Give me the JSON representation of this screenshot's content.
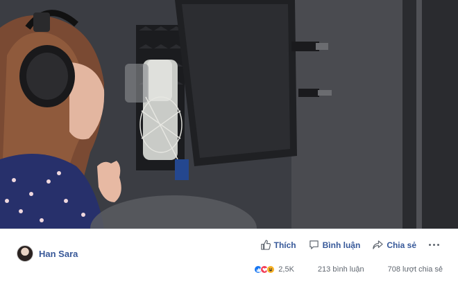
{
  "post": {
    "author_name": "Han Sara",
    "author_avatar": "avatar-image"
  },
  "actions": {
    "like_label": "Thích",
    "comment_label": "Bình luận",
    "share_label": "Chia sẻ",
    "more_icon": "more-horizontal-icon"
  },
  "stats": {
    "reactions_count": "2,5K",
    "reaction_icons": [
      "like",
      "love",
      "haha"
    ],
    "comments": "213 bình luận",
    "shares": "708 lượt chia sẻ"
  },
  "colors": {
    "link_blue": "#385898",
    "action_blue": "#365899",
    "like_blue": "#1877f2",
    "love_red": "#f33e58",
    "haha_yellow": "#f7b125",
    "muted_text": "#606770"
  }
}
